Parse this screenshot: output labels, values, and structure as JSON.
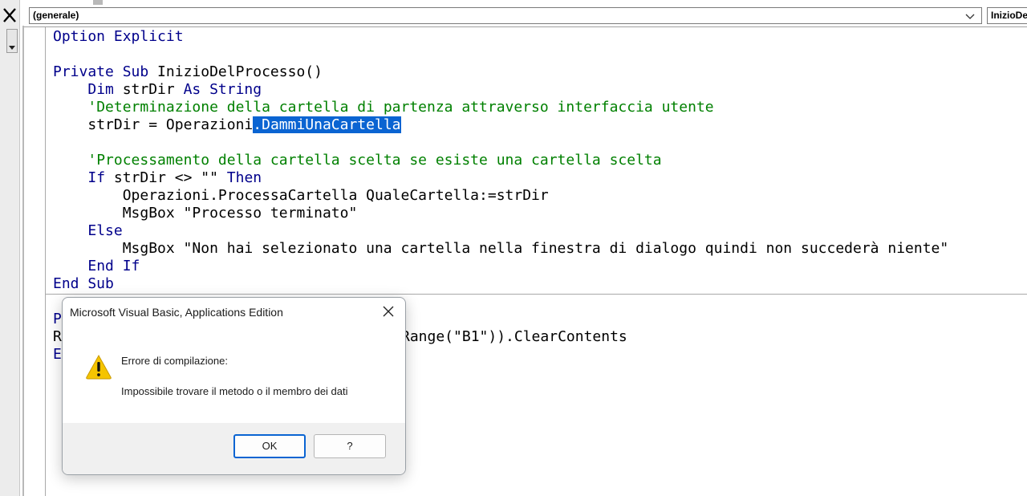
{
  "toolbar": {
    "object_combo": "(generale)",
    "procedure_combo": "InizioDelProcesso"
  },
  "code": {
    "line1_kw": "Option Explicit",
    "line2_kw1": "Private Sub",
    "line2_rest": " InizioDelProcesso()",
    "line3_kw1": "Dim",
    "line3_mid": " strDir ",
    "line3_kw2": "As String",
    "line4_comment": "'Determinazione della cartella di partenza attraverso interfaccia utente",
    "line5_pre": "strDir = Operazioni",
    "line5_sel": ".DammiUnaCartella",
    "line6_comment": "'Processamento della cartella scelta se esiste una cartella scelta",
    "line7_kw1": "If",
    "line7_mid": " strDir <> \"\" ",
    "line7_kw2": "Then",
    "line8": "Operazioni.ProcessaCartella QualeCartella:=strDir",
    "line9": "MsgBox \"Processo terminato\"",
    "line10_kw": "Else",
    "line11": "MsgBox \"Non hai selezionato una cartella nella finestra di dialogo quindi non succederà niente\"",
    "line12_kw": "End If",
    "line13_kw": "End Sub",
    "line14_partial": "P",
    "line15_partial": "R",
    "line15_tail": "Range(\"B1\")).ClearContents",
    "line16_partial": "E"
  },
  "dialog": {
    "title": "Microsoft Visual Basic, Applications Edition",
    "message_title": "Errore di compilazione:",
    "message_body": "Impossibile trovare il metodo o il membro dei dati",
    "ok_label": "OK",
    "help_label": "?"
  },
  "colors": {
    "keyword": "#00008b",
    "comment": "#008000",
    "selection": "#0a64d2",
    "warning_icon": "#f5c400"
  },
  "icons": [
    "close-icon",
    "chevron-down-icon",
    "warning-icon",
    "dialog-close-icon"
  ]
}
